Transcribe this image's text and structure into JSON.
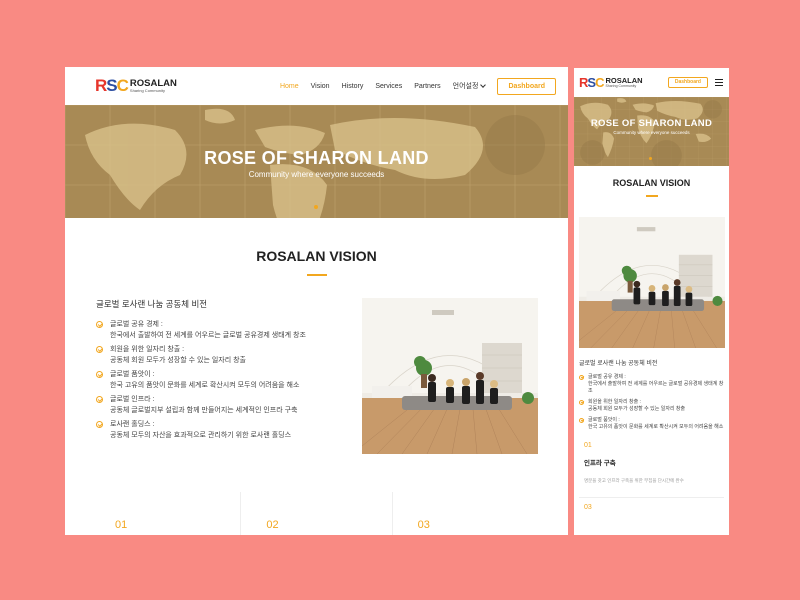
{
  "brand": {
    "mark_r": "R",
    "mark_s": "S",
    "mark_c": "C",
    "name": "ROSALAN",
    "tagline": "Sharing Community"
  },
  "nav": {
    "items": [
      "Home",
      "Vision",
      "History",
      "Services",
      "Partners"
    ],
    "language": "언어설정",
    "dashboard": "Dashboard"
  },
  "hero": {
    "title": "ROSE OF SHARON LAND",
    "subtitle": "Community where everyone succeeds"
  },
  "vision": {
    "title": "ROSALAN VISION",
    "intro": "글로벌 로사랜 나눔 공동체 비전",
    "features": [
      {
        "title": "글로벌 공유 경제 :",
        "desc": "한국에서 출발하여 전 세계를 어우르는 글로벌 공유경제 생태계 창조"
      },
      {
        "title": "회원을 위한 일자리 창출 :",
        "desc": "공동체 회원 모두가 성장할 수 있는 일자리 창출"
      },
      {
        "title": "글로벌 품앗이 :",
        "desc": "한국 고유의 품앗이 문화를 세계로 확산시켜 모두의 어려움을 해소"
      },
      {
        "title": "글로벌 인프라 :",
        "desc": "공동체 글로벌지부 설립과 함께 만들어지는 세계적인 인프라 구축"
      },
      {
        "title": "로사랜 홀딩스 :",
        "desc": "공동체 모두의 자산을 효과적으로 관리하기 위한 로사랜 홀딩스"
      }
    ]
  },
  "numbers": [
    "01",
    "02",
    "03"
  ],
  "mobile": {
    "features": [
      {
        "title": "글로벌 공유 경제 :",
        "desc": "한국에서 출발하여 전 세계를 어우르는 글로벌 공유경제 생태계 창조"
      },
      {
        "title": "회원을 위한 일자리 창출 :",
        "desc": "공동체 회원 모두가 성장할 수 있는 일자리 창출"
      },
      {
        "title": "글로벌 품앗이 :",
        "desc": "한국 고유의 품앗이 문화를 세계로 확산시켜 모두의 어려움을 해소"
      }
    ],
    "card": {
      "number": "01",
      "title": "인프라 구축",
      "desc": "명분을 갖고 인프라 구축을 위한 부집을 단시간에 완수"
    },
    "next_number": "03"
  },
  "colors": {
    "background": "#f98a83",
    "accent": "#f2a71f",
    "hero": "#a88a55"
  }
}
